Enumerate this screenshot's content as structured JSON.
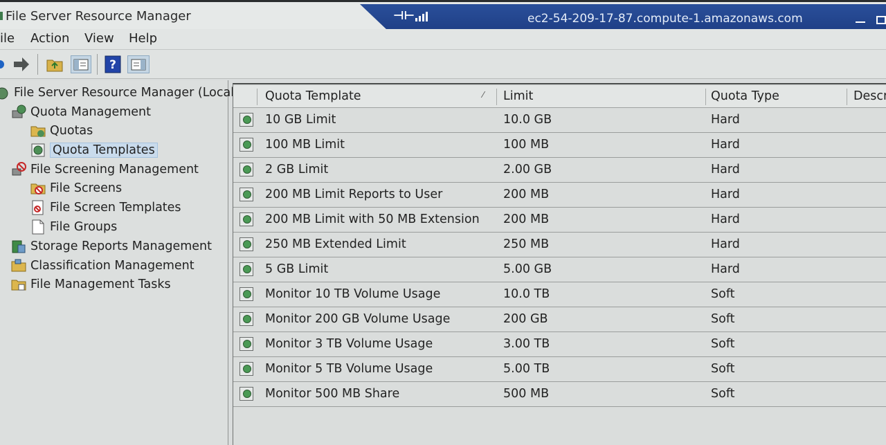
{
  "window": {
    "title": "File Server Resource Manager",
    "remote_host": "ec2-54-209-17-87.compute-1.amazonaws.com"
  },
  "menu": [
    "ile",
    "Action",
    "View",
    "Help"
  ],
  "toolbar_icons": [
    "back-arrow-icon",
    "forward-arrow-icon",
    "up-folder-icon",
    "show-hide-tree-icon",
    "help-icon",
    "show-hide-action-pane-icon"
  ],
  "tree": [
    {
      "label": "File Server Resource Manager (Local)",
      "icon": "fsrm-icon"
    },
    {
      "label": "Quota Management",
      "icon": "quota-management-icon"
    },
    {
      "label": "Quotas",
      "icon": "folder-icon"
    },
    {
      "label": "Quota Templates",
      "icon": "quota-template-icon",
      "selected": true
    },
    {
      "label": "File Screening Management",
      "icon": "file-screening-icon"
    },
    {
      "label": "File Screens",
      "icon": "file-screen-icon"
    },
    {
      "label": "File Screen Templates",
      "icon": "file-screen-template-icon"
    },
    {
      "label": "File Groups",
      "icon": "document-icon"
    },
    {
      "label": "Storage Reports Management",
      "icon": "storage-reports-icon"
    },
    {
      "label": "Classification Management",
      "icon": "classification-icon"
    },
    {
      "label": "File Management Tasks",
      "icon": "tasks-folder-icon"
    }
  ],
  "columns": {
    "template": "Quota Template",
    "limit": "Limit",
    "type": "Quota Type",
    "description": "Descri"
  },
  "rows": [
    {
      "name": "10 GB Limit",
      "limit": "10.0 GB",
      "type": "Hard"
    },
    {
      "name": "100 MB Limit",
      "limit": "100 MB",
      "type": "Hard"
    },
    {
      "name": "2 GB Limit",
      "limit": "2.00 GB",
      "type": "Hard"
    },
    {
      "name": "200 MB Limit Reports to User",
      "limit": "200 MB",
      "type": "Hard"
    },
    {
      "name": "200 MB Limit with 50 MB Extension",
      "limit": "200 MB",
      "type": "Hard"
    },
    {
      "name": "250 MB Extended Limit",
      "limit": "250 MB",
      "type": "Hard"
    },
    {
      "name": "5 GB Limit",
      "limit": "5.00 GB",
      "type": "Hard"
    },
    {
      "name": "Monitor 10 TB Volume Usage",
      "limit": "10.0 TB",
      "type": "Soft"
    },
    {
      "name": "Monitor 200 GB Volume Usage",
      "limit": "200 GB",
      "type": "Soft"
    },
    {
      "name": "Monitor 3 TB Volume Usage",
      "limit": "3.00 TB",
      "type": "Soft"
    },
    {
      "name": "Monitor 5 TB Volume Usage",
      "limit": "5.00 TB",
      "type": "Soft"
    },
    {
      "name": "Monitor 500 MB Share",
      "limit": "500 MB",
      "type": "Soft"
    }
  ]
}
